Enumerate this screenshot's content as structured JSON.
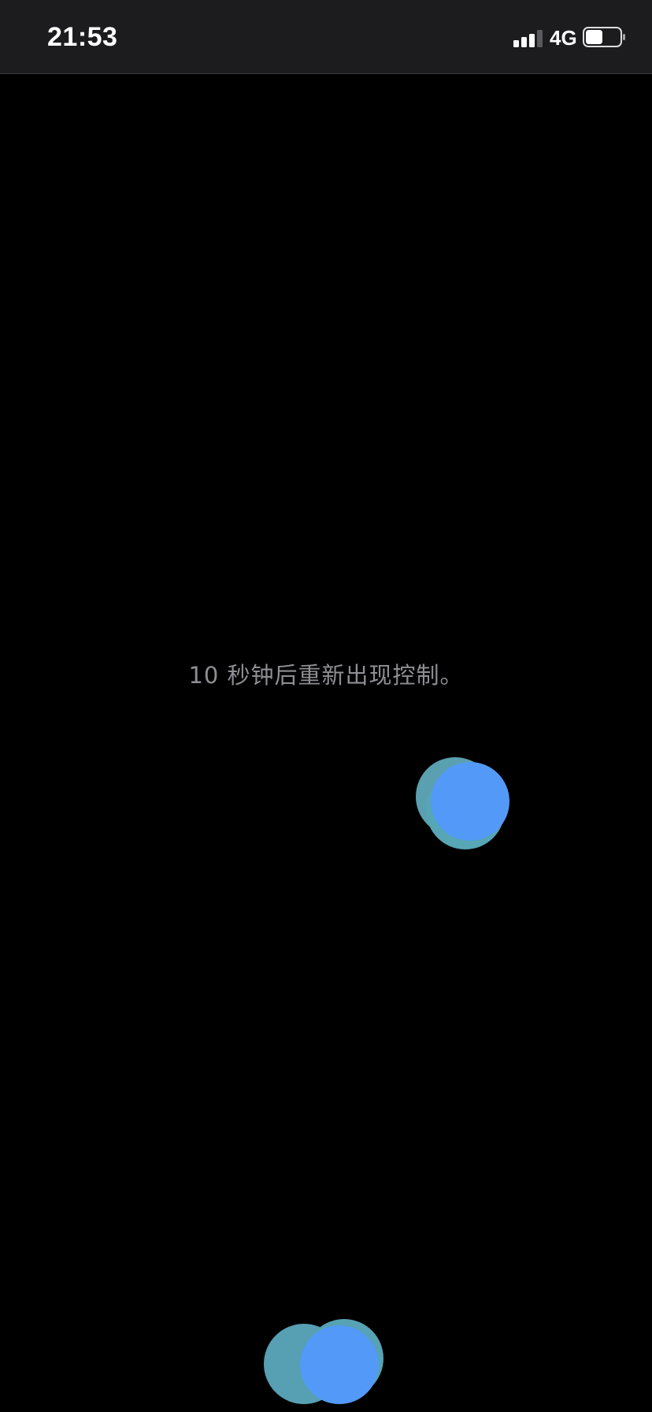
{
  "status_bar": {
    "time": "21:53",
    "network": "4G",
    "signal_icon": "cellular-signal-icon",
    "battery_icon": "battery-icon",
    "battery_level": 0.5
  },
  "main": {
    "hint": "10 秒钟后重新出现控制。"
  },
  "colors": {
    "background": "#000000",
    "status_bar": "#1c1c1e",
    "hint_text": "#8e8e93",
    "bubble_blue": "#5399f7",
    "bubble_teal": "#56a6b5"
  }
}
